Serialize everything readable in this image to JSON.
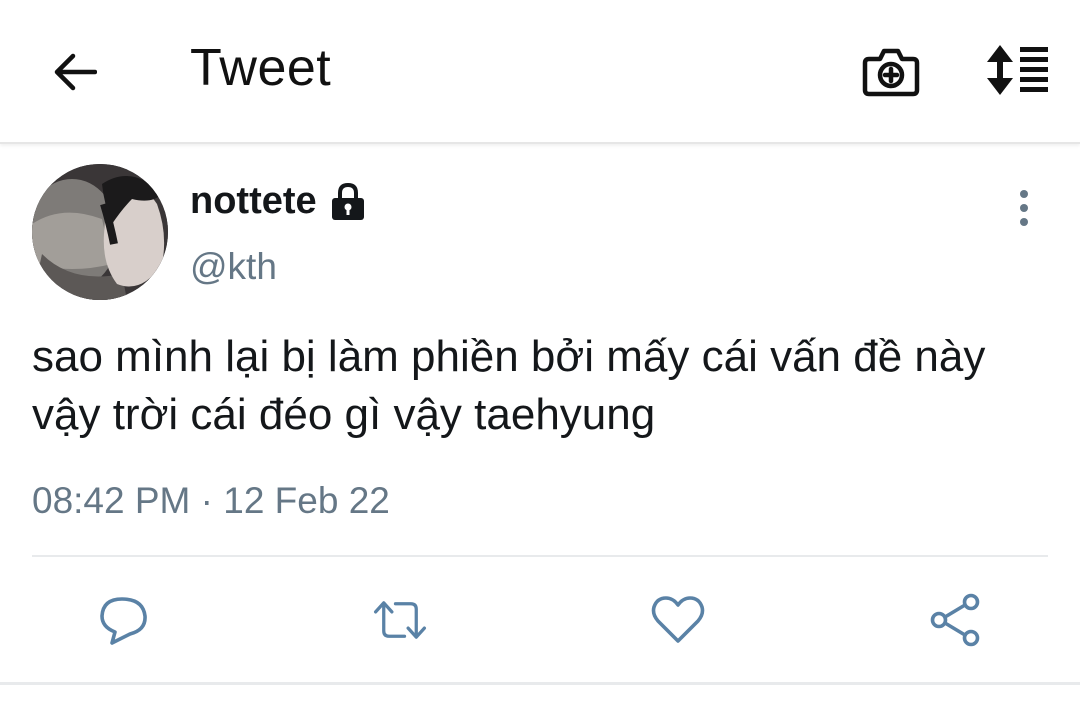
{
  "header": {
    "title": "Tweet",
    "back_icon": "arrow-left-icon",
    "camera_icon": "camera-add-icon",
    "sort_icon": "sort-list-icon"
  },
  "tweet": {
    "display_name": "nottete",
    "protected_icon": "lock-icon",
    "handle": "@kth",
    "text": "sao mình lại bị làm phiền bởi mấy cái vấn đề này vậy trời cái đéo gì vậy taehyung",
    "timestamp": "08:42 PM · 12 Feb 22"
  },
  "actions": {
    "reply_icon": "reply-bubble-icon",
    "retweet_icon": "retweet-icon",
    "like_icon": "heart-icon",
    "share_icon": "share-icon"
  },
  "colors": {
    "text": "#14171a",
    "secondary_text": "#657786",
    "icon_blue": "#5a82a6",
    "divider": "#e8eaec"
  }
}
